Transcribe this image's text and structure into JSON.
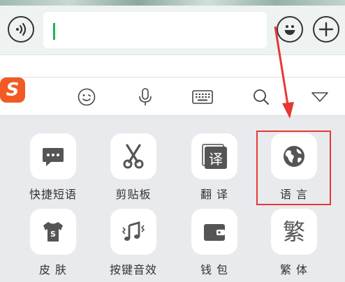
{
  "chat_bar": {
    "message_input": {
      "value": "",
      "placeholder": ""
    }
  },
  "toolbar": {
    "logo_letter": "S",
    "items": [
      "sogou-logo",
      "emoji-icon",
      "microphone-icon",
      "keyboard-icon",
      "search-icon",
      "collapse-icon"
    ]
  },
  "menu": {
    "items": [
      {
        "label": "快捷短语",
        "icon": "message-bubble-icon"
      },
      {
        "label": "剪贴板",
        "icon": "scissors-icon"
      },
      {
        "label": "翻 译",
        "icon": "translate-icon",
        "glyph": "译"
      },
      {
        "label": "语 言",
        "icon": "globe-icon"
      },
      {
        "label": "皮 肤",
        "icon": "tshirt-icon"
      },
      {
        "label": "按键音效",
        "icon": "music-note-icon"
      },
      {
        "label": "钱 包",
        "icon": "wallet-icon"
      },
      {
        "label": "繁 体",
        "icon": "traditional-chinese-icon",
        "glyph": "繁"
      }
    ]
  },
  "colors": {
    "highlight_box": "#e53935",
    "annotation_arrow": "#e53935",
    "caret": "#20b251",
    "logo_bg": "#f15a22"
  }
}
